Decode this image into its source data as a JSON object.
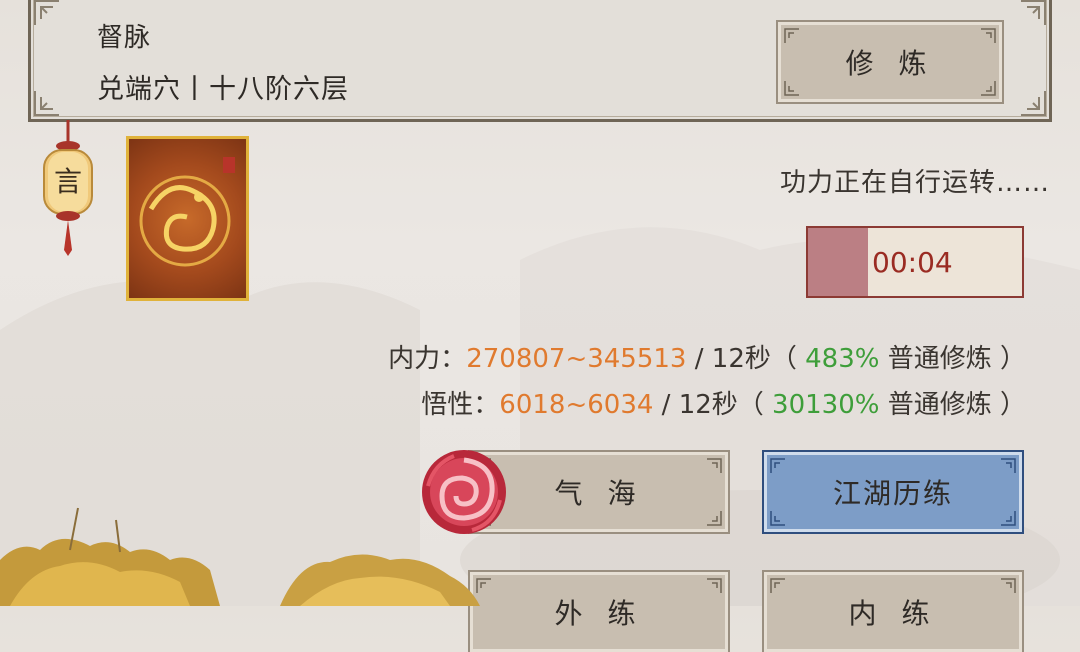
{
  "meridian": {
    "name": "督脉",
    "acupoint_stage": "兑端穴丨十八阶六层"
  },
  "buttons": {
    "cultivate": "修 炼",
    "qihai": "气 海",
    "jianghu": "江湖历练",
    "waigong": "外 练",
    "neigong": "内 练"
  },
  "lantern": {
    "char": "言"
  },
  "status": {
    "text": "功力正在自行运转……",
    "timer": "00:04",
    "progress": 0.28
  },
  "stats": [
    {
      "label": "内力：",
      "range": "270807~345513",
      "per": " / 12秒（ ",
      "pct": "483%",
      "mode": " 普通修炼 ）"
    },
    {
      "label": "悟性：",
      "range": "6018~6034",
      "per": " / 12秒（ ",
      "pct": "30130%",
      "mode": " 普通修炼 ）"
    }
  ],
  "colors": {
    "accent_orange": "#e07a2e",
    "accent_green": "#3e9e3a",
    "timer_red": "#9a2b22",
    "blue_button": "#7d9dc7"
  },
  "icons": [
    "lantern-icon",
    "dragon-art-card",
    "swirl-vortex-icon",
    "golden-tree-decoration"
  ]
}
